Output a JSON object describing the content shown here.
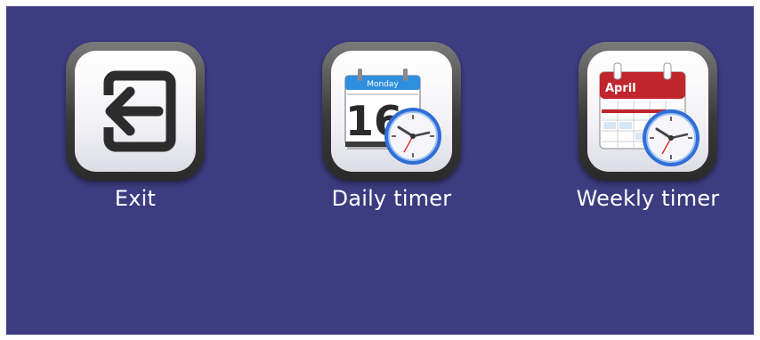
{
  "menu": {
    "items": [
      {
        "label": "Exit",
        "icon": "exit-icon"
      },
      {
        "label": "Daily timer",
        "icon": "daily-calendar-clock-icon",
        "calendar_day": "Monday",
        "calendar_date": "16"
      },
      {
        "label": "Weekly timer",
        "icon": "weekly-calendar-clock-icon",
        "calendar_month": "April"
      }
    ]
  },
  "colors": {
    "background": "#3d3c80",
    "label_text": "#ffffff",
    "calendar_header_blue": "#2f8fdf",
    "calendar_header_red": "#c0262d",
    "clock_ring": "#2f6fd6"
  }
}
